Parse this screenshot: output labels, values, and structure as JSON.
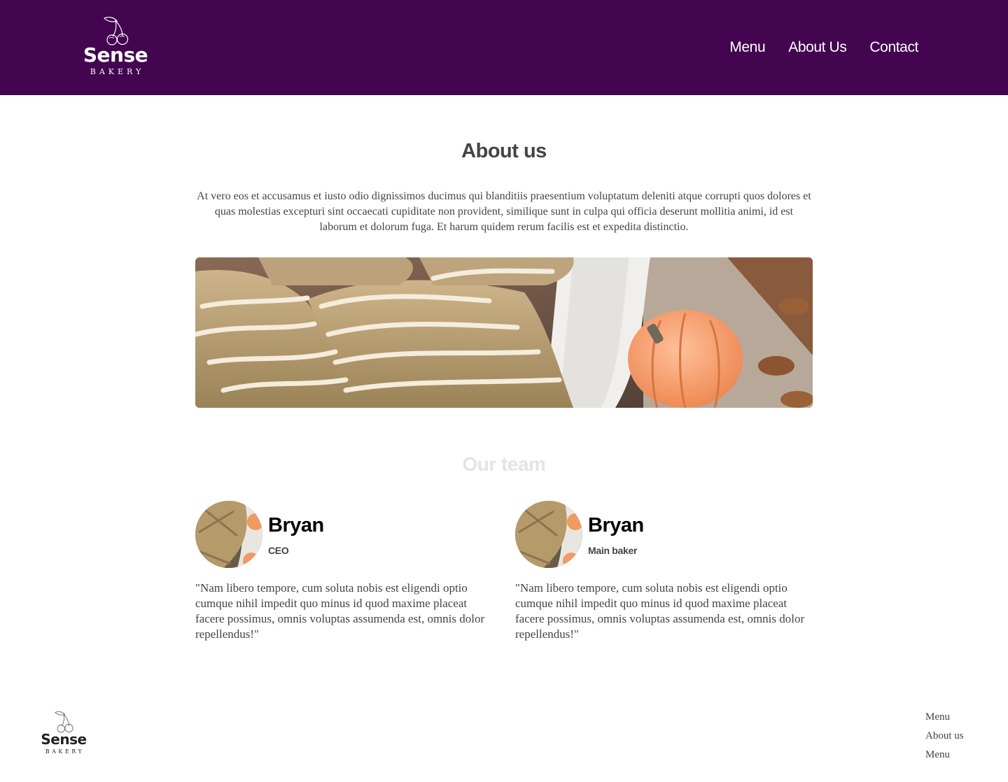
{
  "brand": {
    "name": "Sense",
    "tagline": "BAKERY",
    "header_bg": "#430450",
    "logo_icon": "cherry-icon"
  },
  "nav": {
    "items": [
      "Menu",
      "About Us",
      "Contact"
    ]
  },
  "about": {
    "title": "About us",
    "text": "At vero eos et accusamus et iusto odio dignissimos ducimus qui blanditiis praesentium voluptatum deleniti atque corrupti quos dolores et quas molestias excepturi sint occaecati cupiditate non provident, similique sunt in culpa qui officia deserunt mollitia animi, id est laborum et dolorum fuga. Et harum quidem rerum facilis est et expedita distinctio."
  },
  "team": {
    "title": "Our team",
    "members": [
      {
        "name": "Bryan",
        "role": "CEO",
        "quote": "\"Nam libero tempore, cum soluta nobis est eligendi optio cumque nihil impedit quo minus id quod maxime placeat facere possimus, omnis voluptas assumenda est, omnis dolor repellendus!\""
      },
      {
        "name": "Bryan",
        "role": "Main baker",
        "quote": "\"Nam libero tempore, cum soluta nobis est eligendi optio cumque nihil impedit quo minus id quod maxime placeat facere possimus, omnis voluptas assumenda est, omnis dolor repellendus!\""
      }
    ]
  },
  "footer": {
    "links": [
      "Menu",
      "About us",
      "Menu"
    ]
  }
}
